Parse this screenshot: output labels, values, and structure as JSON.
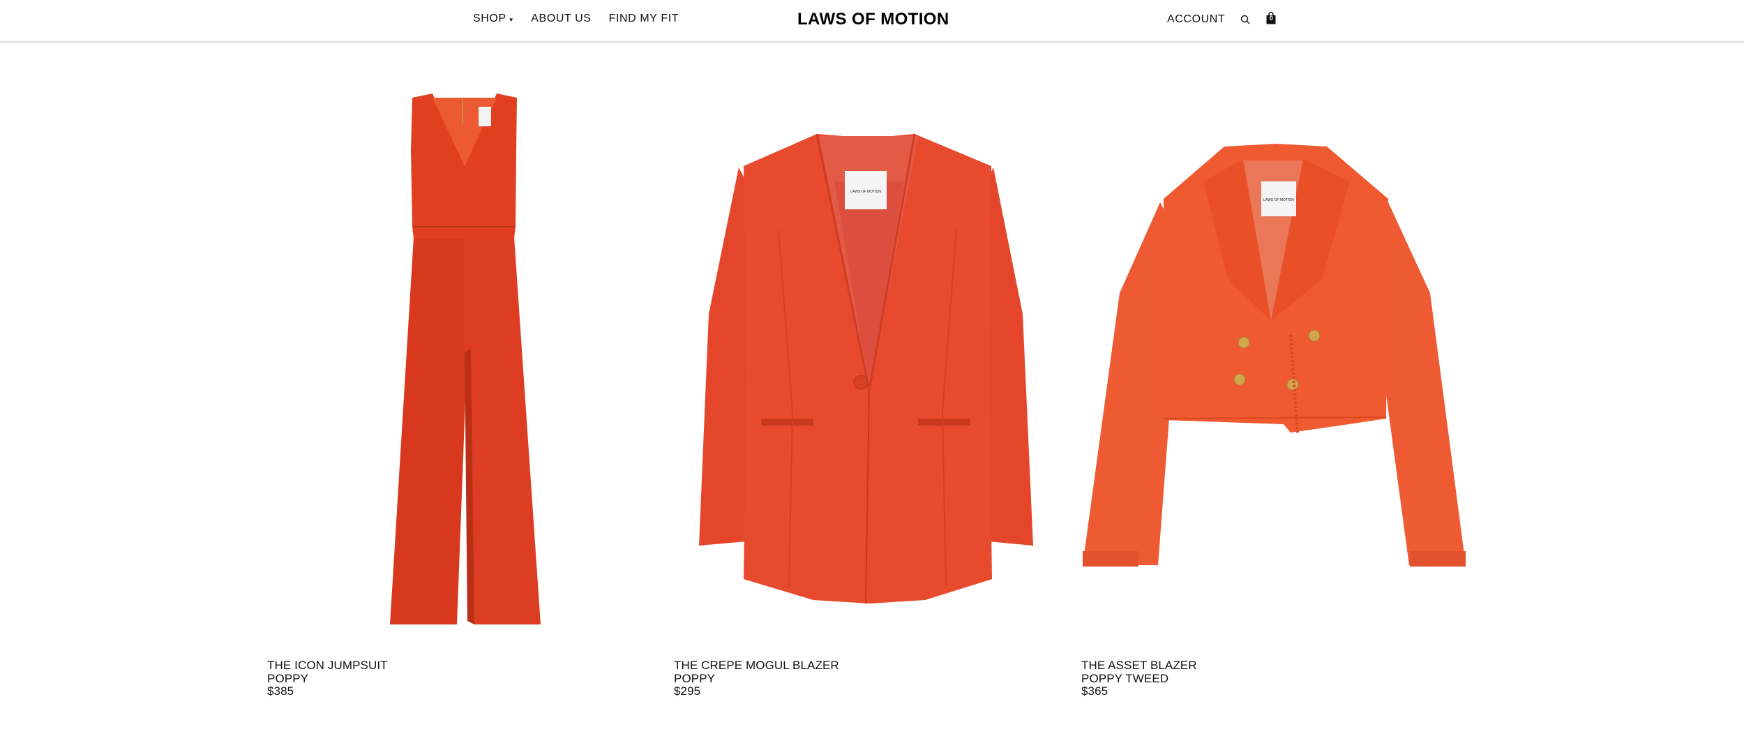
{
  "header": {
    "nav": {
      "shop": "SHOP",
      "about": "ABOUT US",
      "find_fit": "FIND MY FIT"
    },
    "logo": "LAWS OF MOTION",
    "account": "ACCOUNT",
    "cart_count": "0",
    "icons": [
      "chevron-down-icon",
      "search-icon",
      "shopping-bag-icon"
    ]
  },
  "products": [
    {
      "name": "THE ICON JUMPSUIT",
      "color": "POPPY",
      "price": "$385",
      "image": "jumpsuit"
    },
    {
      "name": "THE CREPE MOGUL BLAZER",
      "color": "POPPY",
      "price": "$295",
      "image": "crepe-blazer"
    },
    {
      "name": "THE ASSET BLAZER",
      "color": "POPPY TWEED",
      "price": "$365",
      "image": "tweed-blazer"
    }
  ],
  "brand_colors": {
    "poppy": "#e5442a",
    "poppy_dark": "#cc3a1f",
    "tweed": "#ef5a32",
    "border": "#dcdcdc"
  }
}
